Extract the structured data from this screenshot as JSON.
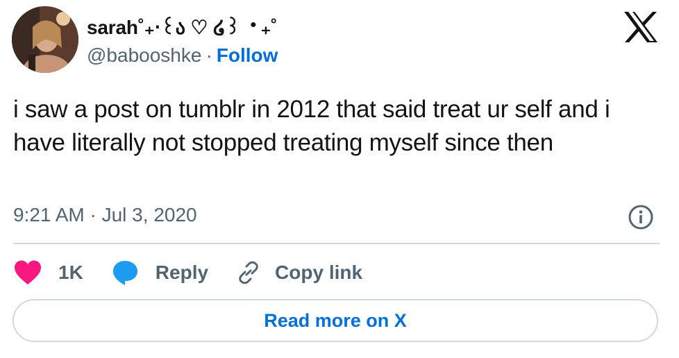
{
  "author": {
    "name": "sarah˚₊‧꒰ა ♡ ໒꒱ ‧₊˚",
    "handle": "@babooshke",
    "separator": "·",
    "follow_label": "Follow"
  },
  "tweet": {
    "text": "i saw a post on tumblr in 2012 that said treat ur self and i have literally not stopped treating myself since then",
    "timestamp": "9:21 AM · Jul 3, 2020"
  },
  "actions": {
    "like_count": "1K",
    "reply_label": "Reply",
    "copy_label": "Copy link"
  },
  "read_more_label": "Read more on X",
  "icons": {
    "brand": "x-logo-icon",
    "info": "info-icon",
    "like": "heart-icon",
    "reply": "speech-bubble-icon",
    "copy": "link-icon"
  },
  "colors": {
    "like": "#f91880",
    "reply": "#1d9bf0",
    "link": "#006fd6",
    "secondary_text": "#536471",
    "border": "#cfd9de"
  }
}
